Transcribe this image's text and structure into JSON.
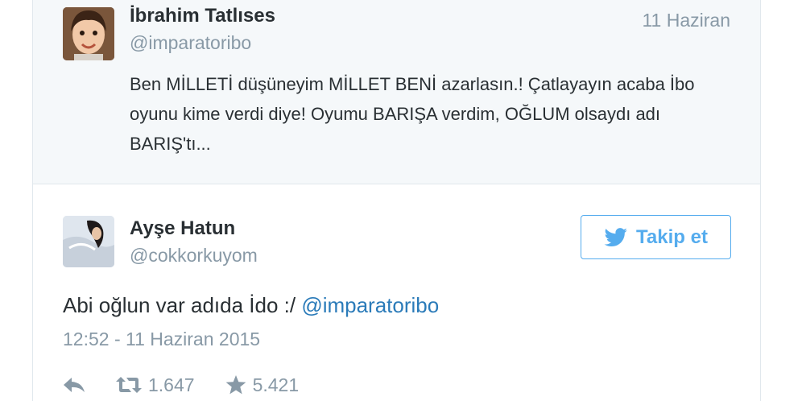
{
  "quoted_tweet": {
    "name": "İbrahim Tatlıses",
    "handle": "@imparatoribo",
    "date": "11 Haziran",
    "text": "Ben MİLLETİ düşüneyim MİLLET BENİ azarlasın.! Çatlayayın acaba İbo oyunu kime verdi diye! Oyumu BARIŞA verdim, OĞLUM olsaydı adı BARIŞ'tı..."
  },
  "tweet": {
    "name": "Ayşe Hatun",
    "handle": "@cokkorkuyom",
    "follow_label": "Takip et",
    "text_prefix": "Abi oğlun var adıda İdo :/ ",
    "mention": "@imparatoribo",
    "timestamp": "12:52 - 11 Haziran 2015",
    "retweets": "1.647",
    "favorites": "5.421"
  },
  "icons": {
    "reply": "reply-icon",
    "retweet": "retweet-icon",
    "favorite": "star-icon",
    "follow": "twitter-bird-icon"
  },
  "colors": {
    "accent": "#55acee",
    "link": "#2b7bb9",
    "text": "#292f33",
    "muted": "#8899a6",
    "quoted_bg": "#f5f8fa"
  }
}
